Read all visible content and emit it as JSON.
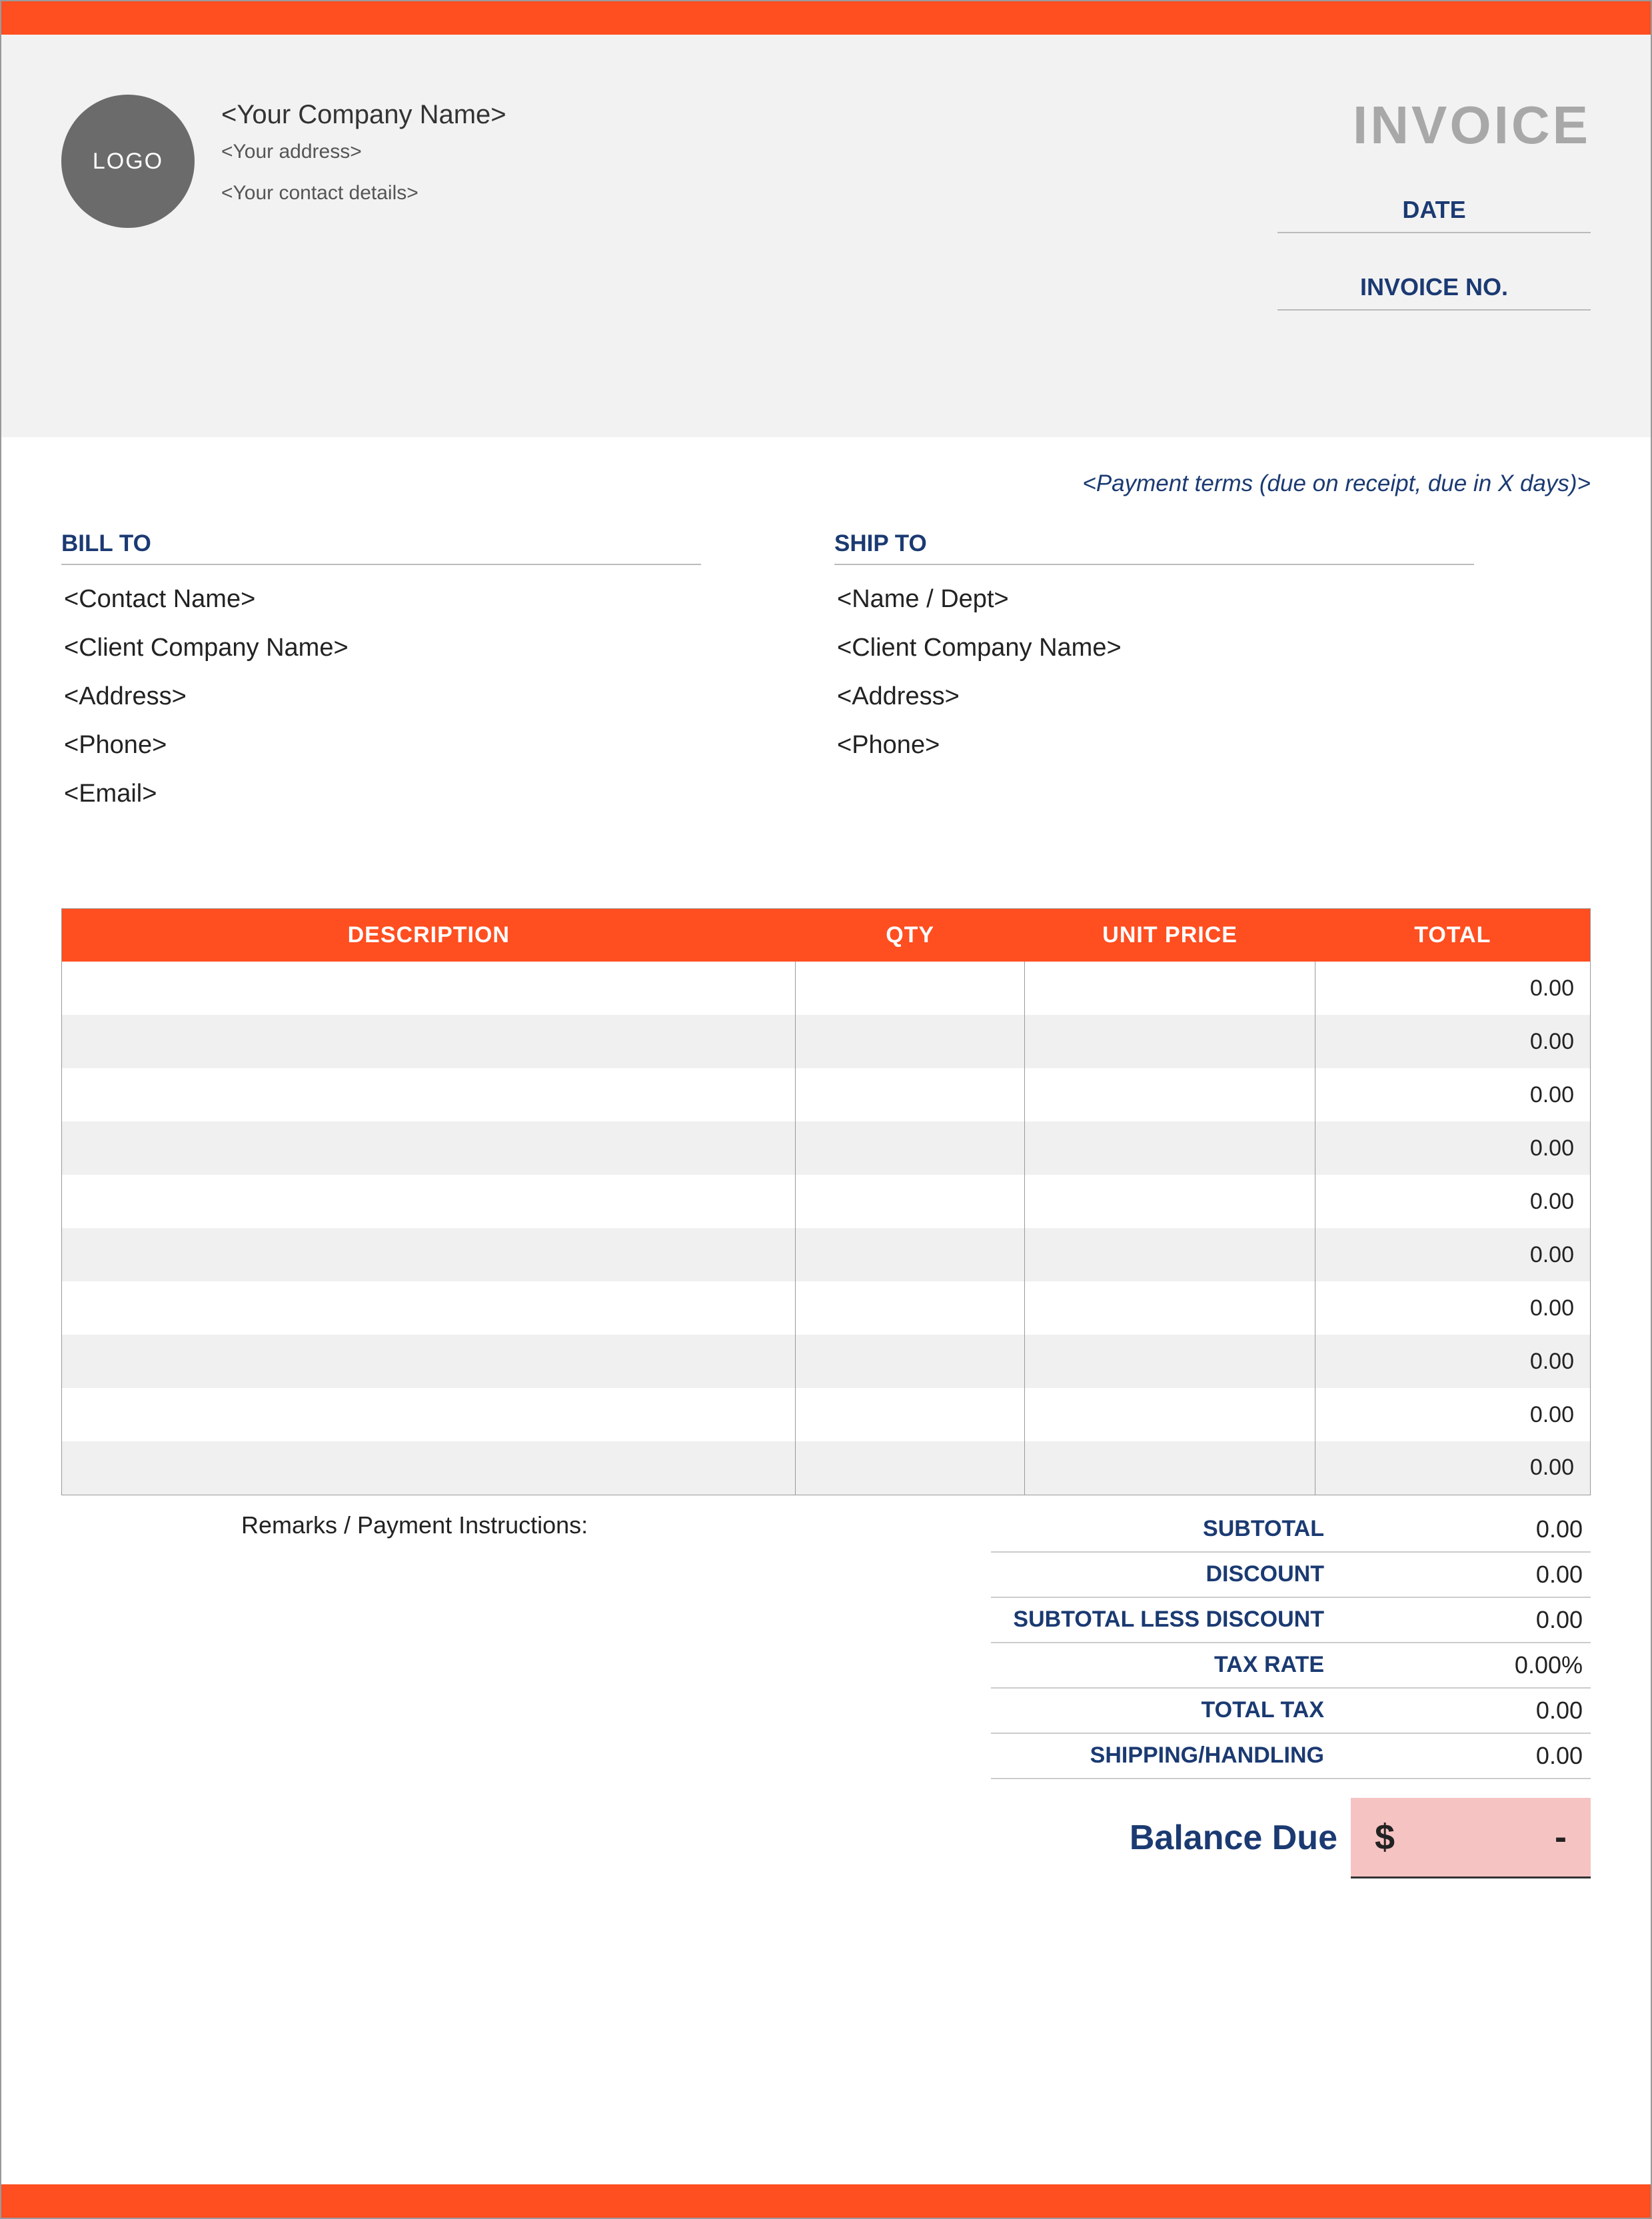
{
  "header": {
    "logo_text": "LOGO",
    "company_name": "<Your Company Name>",
    "address": "<Your address>",
    "contact": "<Your contact details>",
    "invoice_title": "INVOICE",
    "date_label": "DATE",
    "invoice_no_label": "INVOICE NO."
  },
  "payment_terms": "<Payment terms (due on receipt, due in X days)>",
  "bill_to": {
    "heading": "BILL TO",
    "lines": [
      "<Contact Name>",
      "<Client Company Name>",
      "<Address>",
      "<Phone>",
      "<Email>"
    ]
  },
  "ship_to": {
    "heading": "SHIP TO",
    "lines": [
      "<Name / Dept>",
      "<Client Company Name>",
      "<Address>",
      "<Phone>"
    ]
  },
  "columns": {
    "description": "DESCRIPTION",
    "qty": "QTY",
    "unit_price": "UNIT PRICE",
    "total": "TOTAL"
  },
  "items": [
    {
      "description": "",
      "qty": "",
      "unit_price": "",
      "total": "0.00"
    },
    {
      "description": "",
      "qty": "",
      "unit_price": "",
      "total": "0.00"
    },
    {
      "description": "",
      "qty": "",
      "unit_price": "",
      "total": "0.00"
    },
    {
      "description": "",
      "qty": "",
      "unit_price": "",
      "total": "0.00"
    },
    {
      "description": "",
      "qty": "",
      "unit_price": "",
      "total": "0.00"
    },
    {
      "description": "",
      "qty": "",
      "unit_price": "",
      "total": "0.00"
    },
    {
      "description": "",
      "qty": "",
      "unit_price": "",
      "total": "0.00"
    },
    {
      "description": "",
      "qty": "",
      "unit_price": "",
      "total": "0.00"
    },
    {
      "description": "",
      "qty": "",
      "unit_price": "",
      "total": "0.00"
    },
    {
      "description": "",
      "qty": "",
      "unit_price": "",
      "total": "0.00"
    }
  ],
  "remarks_label": "Remarks / Payment Instructions:",
  "totals": {
    "subtotal": {
      "label": "SUBTOTAL",
      "value": "0.00"
    },
    "discount": {
      "label": "DISCOUNT",
      "value": "0.00"
    },
    "subtotal_less_discount": {
      "label": "SUBTOTAL LESS DISCOUNT",
      "value": "0.00"
    },
    "tax_rate": {
      "label": "TAX RATE",
      "value": "0.00%"
    },
    "total_tax": {
      "label": "TOTAL TAX",
      "value": "0.00"
    },
    "shipping": {
      "label": "SHIPPING/HANDLING",
      "value": "0.00"
    }
  },
  "balance": {
    "label": "Balance Due",
    "currency": "$",
    "value": "-"
  }
}
